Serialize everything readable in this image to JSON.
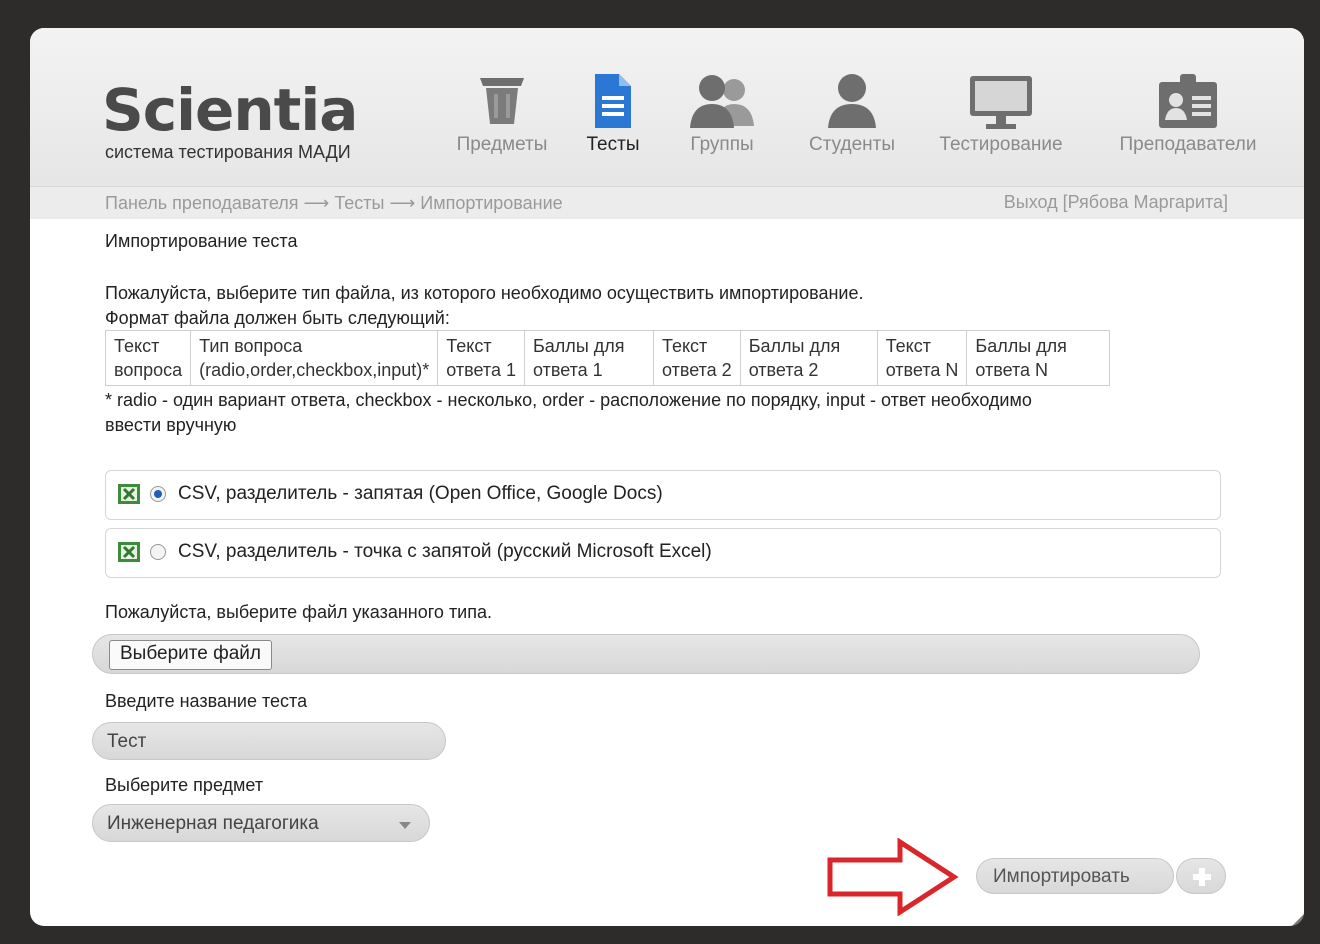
{
  "brand": {
    "name": "Scientia",
    "subtitle": "система тестирования МАДИ"
  },
  "nav": [
    {
      "label": "Предметы",
      "icon": "trash-bin-icon",
      "active": false
    },
    {
      "label": "Тесты",
      "icon": "document-icon",
      "active": true
    },
    {
      "label": "Группы",
      "icon": "users-group-icon",
      "active": false
    },
    {
      "label": "Студенты",
      "icon": "user-icon",
      "active": false
    },
    {
      "label": "Тестирование",
      "icon": "monitor-icon",
      "active": false
    },
    {
      "label": "Преподаватели",
      "icon": "id-badge-icon",
      "active": false
    }
  ],
  "breadcrumb": {
    "text": "Панель преподавателя ⟶ Тесты ⟶ Импортирование",
    "logout": "Выход [Рябова Маргарита]"
  },
  "page_title": "Импортирование теста",
  "intro": {
    "line1": "Пожалуйста, выберите тип файла, из которого необходимо осуществить импортирование.",
    "line2": "Формат файла должен быть следующий:"
  },
  "format_table": [
    [
      "Текст",
      "Тип вопроса",
      "Текст",
      "Баллы для",
      "Текст",
      "Баллы для",
      "Текст",
      "Баллы для"
    ],
    [
      "вопроса",
      "(radio,order,checkbox,input)*",
      "ответа 1",
      "ответа 1",
      "ответа 2",
      "ответа 2",
      "ответа N",
      "ответа N"
    ]
  ],
  "footnote": {
    "line1": "* radio - один вариант ответа, checkbox - несколько, order - расположение по порядку, input - ответ необходимо",
    "line2": "ввести вручную"
  },
  "file_types": [
    {
      "label": "CSV, разделитель - запятая (Open Office, Google Docs)",
      "selected": true,
      "icon": "excel-icon"
    },
    {
      "label": "CSV, разделитель - точка с запятой (русский Microsoft Excel)",
      "selected": false,
      "icon": "excel-icon"
    }
  ],
  "file_prompt": "Пожалуйста, выберите файл указанного типа.",
  "file_button": "Выберите файл",
  "name_label": "Введите название теста",
  "name_value": "Тест",
  "subject_label": "Выберите предмет",
  "subject_value": "Инженерная педагогика",
  "import_button": "Импортировать",
  "colors": {
    "accent": "#1f5fb8",
    "annotation_arrow": "#d9262b"
  }
}
